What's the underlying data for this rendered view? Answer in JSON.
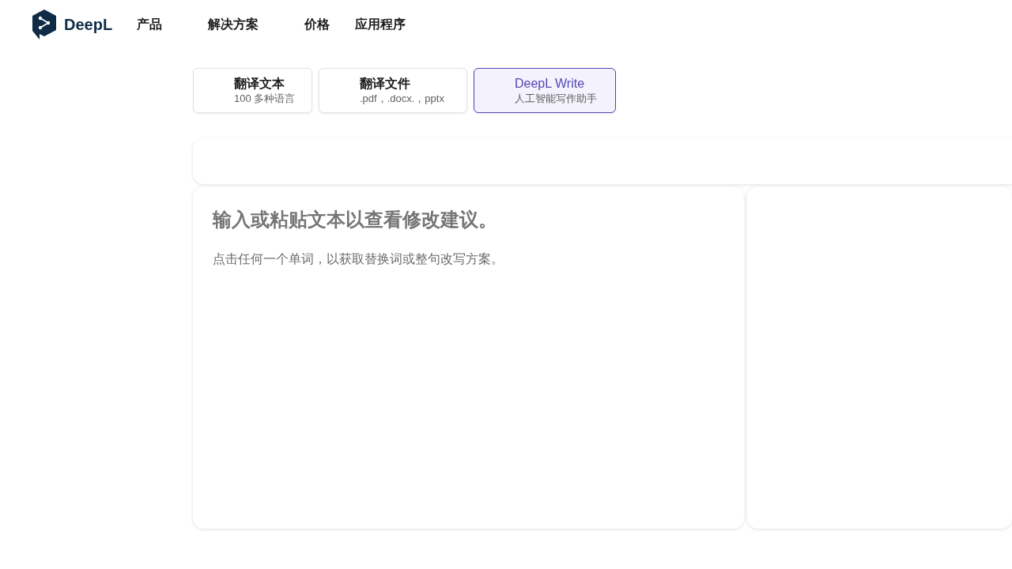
{
  "brand": {
    "name": "DeepL"
  },
  "nav": [
    {
      "label": "产品"
    },
    {
      "label": "解决方案"
    },
    {
      "label": "价格"
    },
    {
      "label": "应用程序"
    }
  ],
  "tabs": [
    {
      "title": "翻译文本",
      "subtitle": "100 多种语言",
      "selected": false
    },
    {
      "title": "翻译文件",
      "subtitle": ".pdf，.docx.，pptx",
      "selected": false
    },
    {
      "title": "DeepL Write",
      "subtitle": "人工智能写作助手",
      "selected": true
    }
  ],
  "editor": {
    "placeholder_title": "输入或粘贴文本以查看修改建议。",
    "placeholder_hint": "点击任何一个单词，以获取替换词或整句改写方案。"
  }
}
